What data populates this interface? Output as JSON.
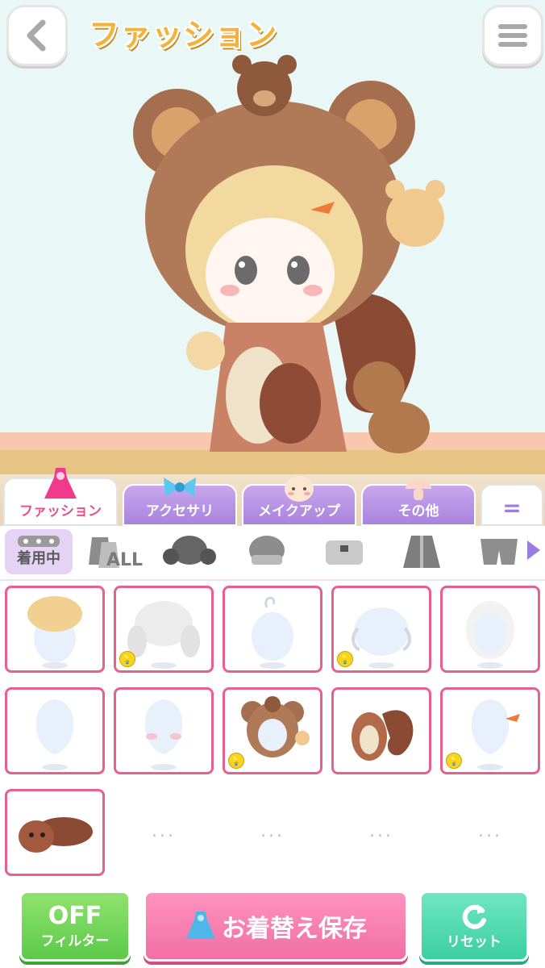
{
  "header": {
    "title": "ファッション",
    "back_icon": "chevron-left-icon",
    "menu_icon": "hamburger-menu-icon"
  },
  "tabs": [
    {
      "label": "ファッション",
      "icon": "dress-icon",
      "active": true
    },
    {
      "label": "アクセサリ",
      "icon": "ribbon-icon",
      "active": false
    },
    {
      "label": "メイクアップ",
      "icon": "face-icon",
      "active": false
    },
    {
      "label": "その他",
      "icon": "mushroom-icon",
      "active": false
    },
    {
      "label": "=",
      "icon": "more-icon",
      "active": false
    }
  ],
  "subcategories": {
    "wearing_label": "着用中",
    "all_label": "ALL",
    "items": [
      "all-clothes-icon",
      "hair-icon",
      "hat-icon",
      "top-icon",
      "jacket-icon",
      "pants-icon"
    ]
  },
  "items": [
    {
      "name": "blonde-updo-hair",
      "hint": false
    },
    {
      "name": "white-twin-braids",
      "hint": true
    },
    {
      "name": "ahoge-hair",
      "hint": false
    },
    {
      "name": "side-hair",
      "hint": true
    },
    {
      "name": "long-wavy-hair",
      "hint": false
    },
    {
      "name": "plain-face",
      "hint": false
    },
    {
      "name": "blush-face",
      "hint": false
    },
    {
      "name": "bear-hood-outfit",
      "hint": true
    },
    {
      "name": "squirrel-costume",
      "hint": false
    },
    {
      "name": "carrot-hairpin",
      "hint": true
    },
    {
      "name": "squirrel-plush",
      "hint": false
    }
  ],
  "empty_slot_label": "...",
  "buttons": {
    "filter_top": "OFF",
    "filter_bottom": "フィルター",
    "save_label": "お着替え保存",
    "reset_label": "リセット"
  },
  "colors": {
    "accent_pink": "#e6628c",
    "tab_purple": "#a883de",
    "filter_green": "#5cc94a",
    "reset_teal": "#3ccf9f"
  }
}
